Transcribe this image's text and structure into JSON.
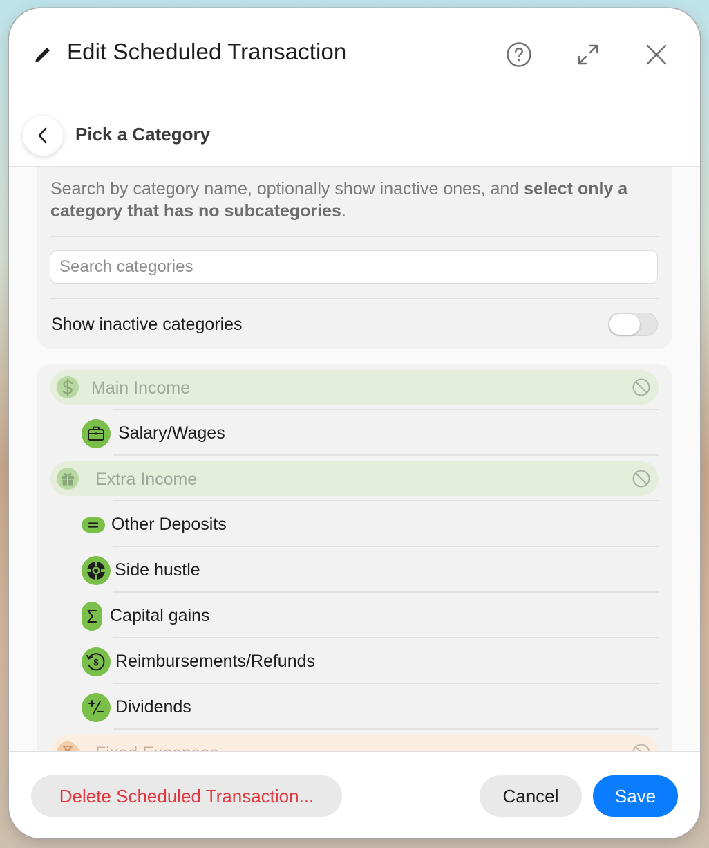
{
  "header": {
    "title": "Edit Scheduled Transaction",
    "icons": [
      "pencil-icon",
      "help-icon",
      "expand-icon",
      "close-icon"
    ]
  },
  "subheader": {
    "title": "Pick a Category",
    "back_icon": "chevron-left-icon"
  },
  "search_section": {
    "instruction_plain": "Search by category name, optionally show inactive ones, and ",
    "instruction_bold": "select only a category that has no subcategories",
    "instruction_end": ".",
    "search_placeholder": "Search categories",
    "search_value": "",
    "toggle_label": "Show inactive categories",
    "toggle_on": false
  },
  "categories": {
    "groups": [
      {
        "label": "Main Income",
        "icon": "dollar-icon",
        "disabled_icon": "prohibited-icon",
        "items": [
          {
            "label": "Salary/Wages",
            "icon": "briefcase-icon"
          }
        ]
      },
      {
        "label": "Extra Income",
        "icon": "gift-icon",
        "disabled_icon": "prohibited-icon",
        "items": [
          {
            "label": "Other Deposits",
            "icon": "equals-icon"
          },
          {
            "label": "Side hustle",
            "icon": "lifebuoy-icon"
          },
          {
            "label": "Capital gains",
            "icon": "sigma-icon"
          },
          {
            "label": "Reimbursements/Refunds",
            "icon": "refund-dollar-icon"
          },
          {
            "label": "Dividends",
            "icon": "plus-minus-icon"
          }
        ]
      },
      {
        "label": "Fixed Expenses",
        "icon": "hourglass-icon",
        "disabled_icon": "prohibited-icon",
        "items": []
      }
    ]
  },
  "footer": {
    "delete_label": "Delete Scheduled Transaction...",
    "cancel_label": "Cancel",
    "save_label": "Save"
  },
  "colors": {
    "accent": "#0a7cff",
    "destructive": "#e0383e",
    "income_group_bg": "#e4eedb",
    "income_icon_green": "#7bbf4b",
    "expense_group_bg": "#fbeee0"
  }
}
